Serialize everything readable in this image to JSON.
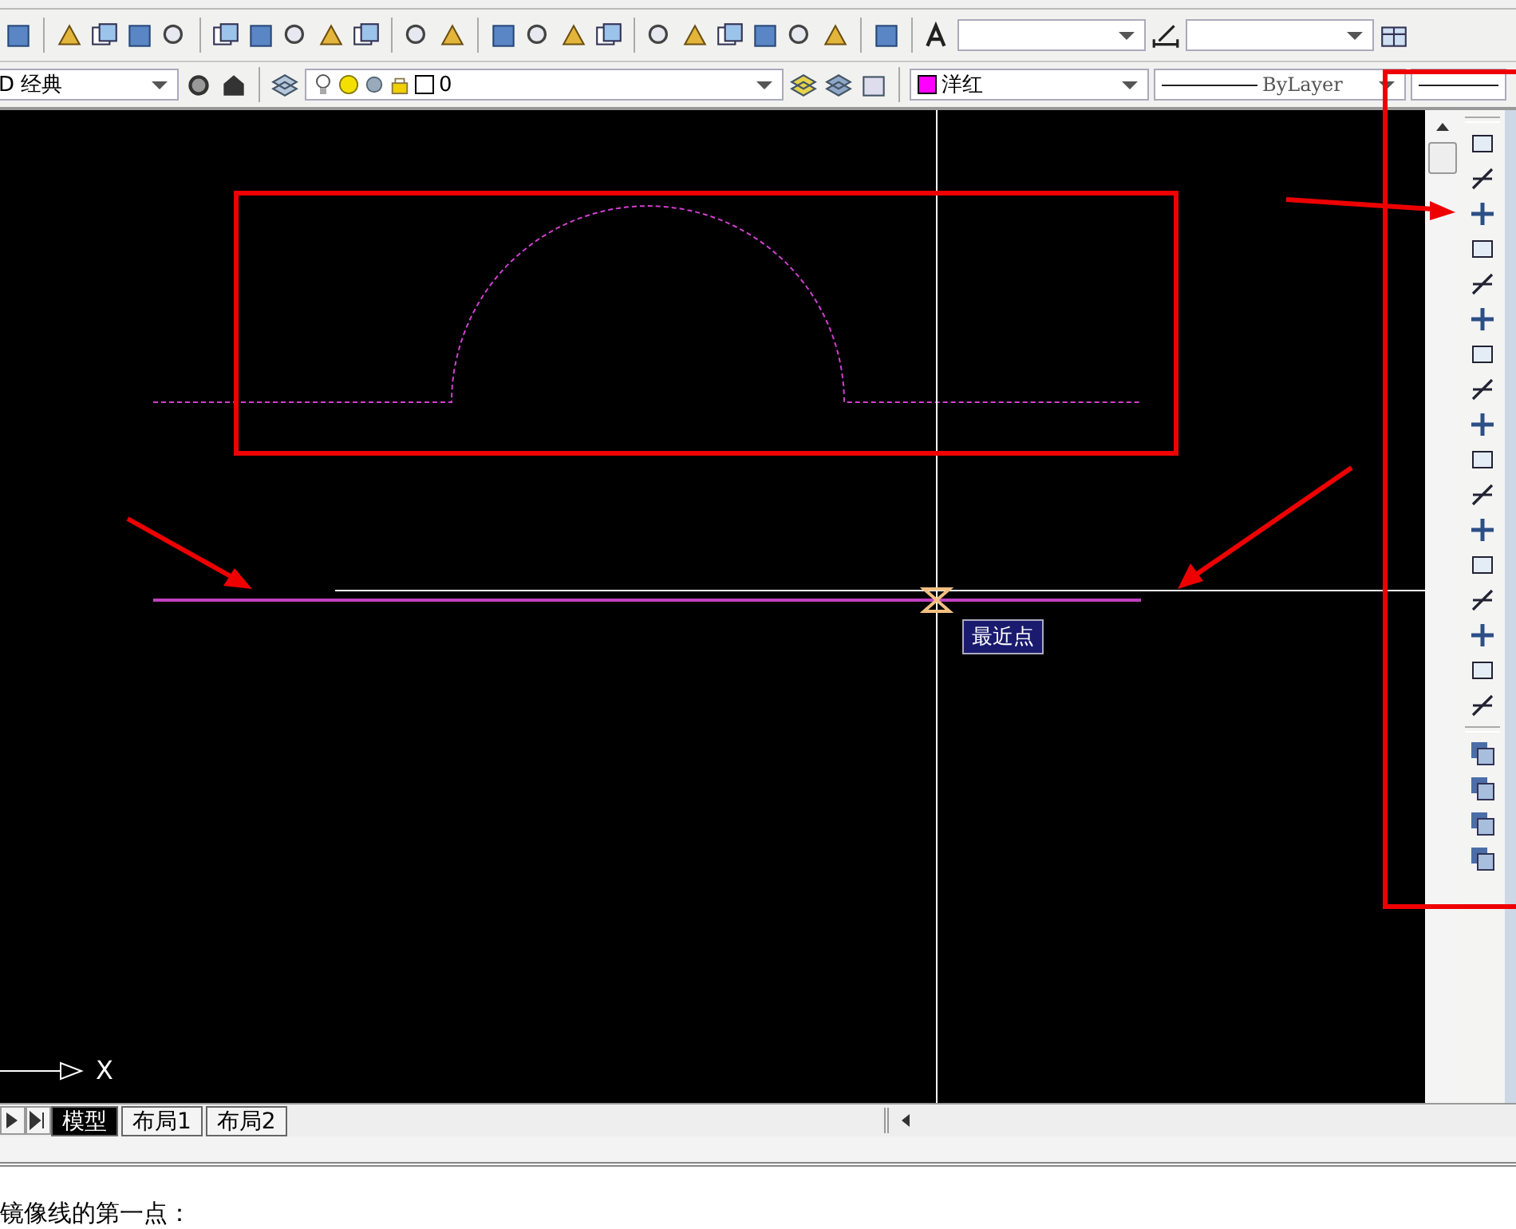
{
  "layers_toolbar": {
    "workspace": "D 经典",
    "layer": "0"
  },
  "properties_toolbar": {
    "color": {
      "name": "洋红",
      "color": "#ff00ff"
    },
    "linetype": "ByLayer"
  },
  "canvas": {
    "tooltip": "最近点",
    "ucs_axis": "X"
  },
  "layout_tabs": [
    {
      "label": "模型",
      "selected": true
    },
    {
      "label": "布局1",
      "selected": false
    },
    {
      "label": "布局2",
      "selected": false
    }
  ],
  "command_line": "镜像线的第一点："
}
